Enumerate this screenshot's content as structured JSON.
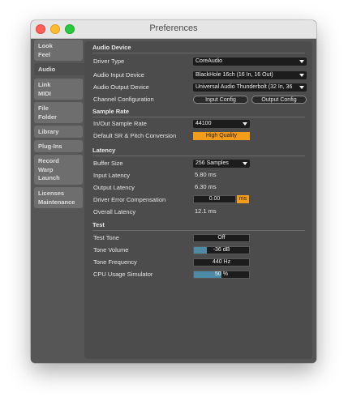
{
  "window": {
    "title": "Preferences"
  },
  "sidebar": {
    "tabs": [
      {
        "lines": [
          "Look",
          "Feel"
        ]
      },
      {
        "lines": [
          "Audio"
        ]
      },
      {
        "lines": [
          "Link",
          "MIDI"
        ]
      },
      {
        "lines": [
          "File",
          "Folder"
        ]
      },
      {
        "lines": [
          "Library"
        ]
      },
      {
        "lines": [
          "Plug-Ins"
        ]
      },
      {
        "lines": [
          "Record",
          "Warp",
          "Launch"
        ]
      },
      {
        "lines": [
          "Licenses",
          "Maintenance"
        ]
      }
    ],
    "active_tab": "Audio"
  },
  "audio_device": {
    "heading": "Audio Device",
    "driver_type_label": "Driver Type",
    "driver_type_value": "CoreAudio",
    "input_device_label": "Audio Input Device",
    "input_device_value": "BlackHole 16ch (16 In, 16 Out)",
    "output_device_label": "Audio Output Device",
    "output_device_value": "Universal Audio Thunderbolt (32 In, 36",
    "channel_config_label": "Channel Configuration",
    "input_config_button": "Input Config",
    "output_config_button": "Output Config"
  },
  "sample_rate": {
    "heading": "Sample Rate",
    "rate_label": "In/Out Sample Rate",
    "rate_value": "44100",
    "conversion_label": "Default SR & Pitch Conversion",
    "conversion_value": "High Quality"
  },
  "latency": {
    "heading": "Latency",
    "buffer_label": "Buffer Size",
    "buffer_value": "256 Samples",
    "input_latency_label": "Input Latency",
    "input_latency_value": "5.80 ms",
    "output_latency_label": "Output Latency",
    "output_latency_value": "6.30 ms",
    "comp_label": "Driver Error Compensation",
    "comp_value": "0.00",
    "comp_unit": "ms",
    "overall_label": "Overall Latency",
    "overall_value": "12.1 ms"
  },
  "test": {
    "heading": "Test",
    "tone_label": "Test Tone",
    "tone_value": "Off",
    "volume_label": "Tone Volume",
    "volume_value": "-36 dB",
    "volume_level": 0.24,
    "freq_label": "Tone Frequency",
    "freq_value": "440 Hz",
    "cpu_label": "CPU Usage Simulator",
    "cpu_value": "50 %",
    "cpu_level": 0.5
  },
  "colors": {
    "accent": "#f39b1a",
    "slider_fill": "#4d8aa6",
    "panel": "#4c4c4c"
  }
}
